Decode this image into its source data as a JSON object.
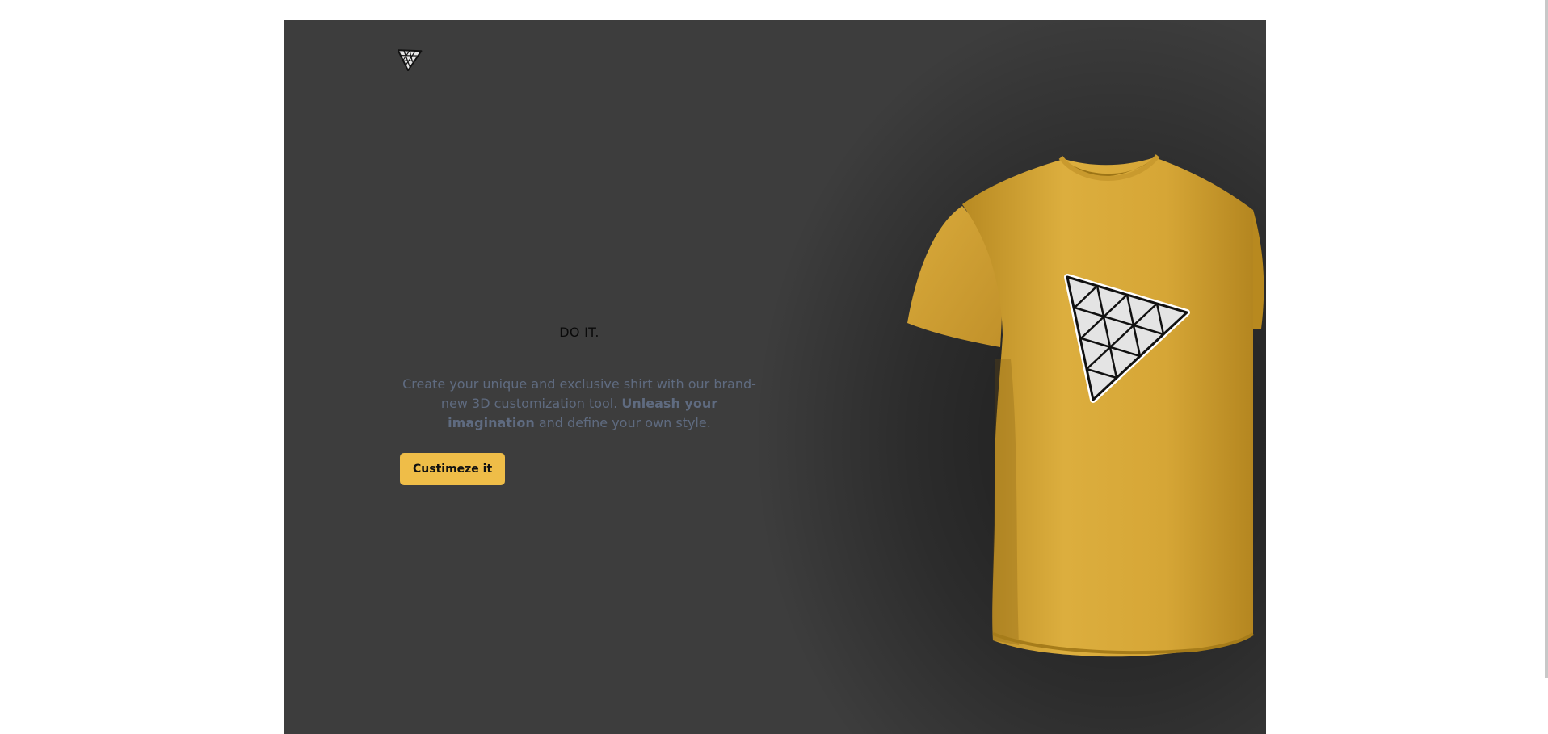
{
  "hero": {
    "headline": "DO IT.",
    "description_part1": "Create your unique and exclusive shirt with our brand-new 3D customization tool. ",
    "description_bold": "Unleash your imagination",
    "description_part2": " and define your own style.",
    "cta_label": "Custimeze it"
  },
  "colors": {
    "stage_background": "#3d3d3d",
    "accent": "#efbd48",
    "shirt": "#d8a93a",
    "description_text": "#5f6b80"
  },
  "icons": {
    "logo": "triangle-grid-logo",
    "shirt_decal": "triangle-grid-decal"
  }
}
